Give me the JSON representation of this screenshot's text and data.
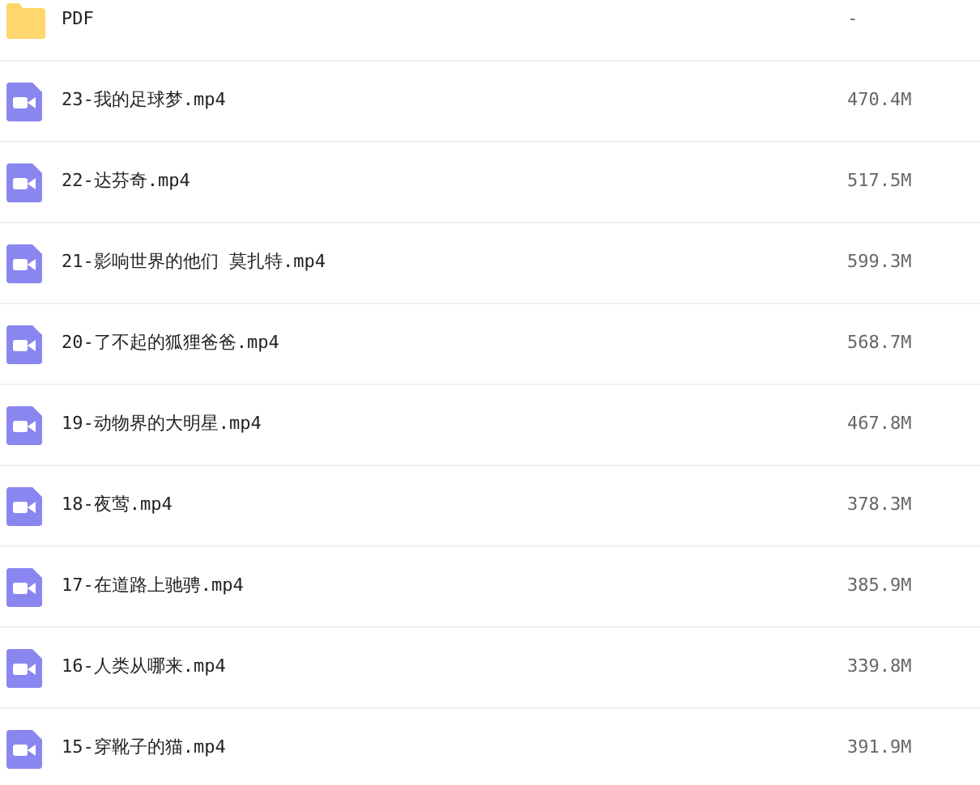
{
  "files": [
    {
      "kind": "folder",
      "name": "PDF",
      "size": "-"
    },
    {
      "kind": "video",
      "name": "23-我的足球梦.mp4",
      "size": "470.4M"
    },
    {
      "kind": "video",
      "name": "22-达芬奇.mp4",
      "size": "517.5M"
    },
    {
      "kind": "video",
      "name": "21-影响世界的他们 莫扎特.mp4",
      "size": "599.3M"
    },
    {
      "kind": "video",
      "name": "20-了不起的狐狸爸爸.mp4",
      "size": "568.7M"
    },
    {
      "kind": "video",
      "name": "19-动物界的大明星.mp4",
      "size": "467.8M"
    },
    {
      "kind": "video",
      "name": "18-夜莺.mp4",
      "size": "378.3M"
    },
    {
      "kind": "video",
      "name": "17-在道路上驰骋.mp4",
      "size": "385.9M"
    },
    {
      "kind": "video",
      "name": "16-人类从哪来.mp4",
      "size": "339.8M"
    },
    {
      "kind": "video",
      "name": "15-穿靴子的猫.mp4",
      "size": "391.9M"
    }
  ]
}
